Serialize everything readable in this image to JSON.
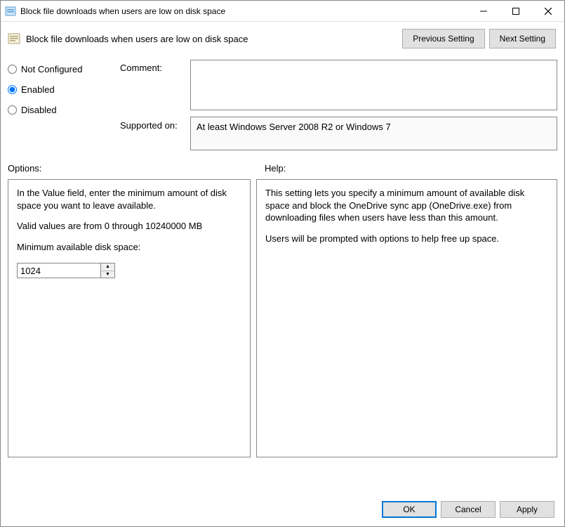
{
  "window": {
    "title": "Block file downloads when users are low on disk space"
  },
  "header": {
    "policy_title": "Block file downloads when users are low on disk space",
    "previous_button": "Previous Setting",
    "next_button": "Next Setting"
  },
  "state": {
    "not_configured": "Not Configured",
    "enabled": "Enabled",
    "disabled": "Disabled",
    "selected": "enabled"
  },
  "labels": {
    "comment": "Comment:",
    "supported_on": "Supported on:",
    "options": "Options:",
    "help": "Help:"
  },
  "supported": {
    "text": "At least Windows Server 2008 R2 or Windows 7"
  },
  "comment": {
    "value": ""
  },
  "options": {
    "para1": "In the Value field, enter the minimum amount of disk space you want to leave available.",
    "para2": "Valid values are from 0 through 10240000 MB",
    "spin_label": "Minimum available disk space:",
    "spin_value": "1024"
  },
  "help": {
    "para1": "This setting lets you specify a minimum amount of available disk space and block the OneDrive sync app (OneDrive.exe) from downloading files when users have less than this amount.",
    "para2": "Users will be prompted with options to help free up space."
  },
  "footer": {
    "ok": "OK",
    "cancel": "Cancel",
    "apply": "Apply"
  }
}
